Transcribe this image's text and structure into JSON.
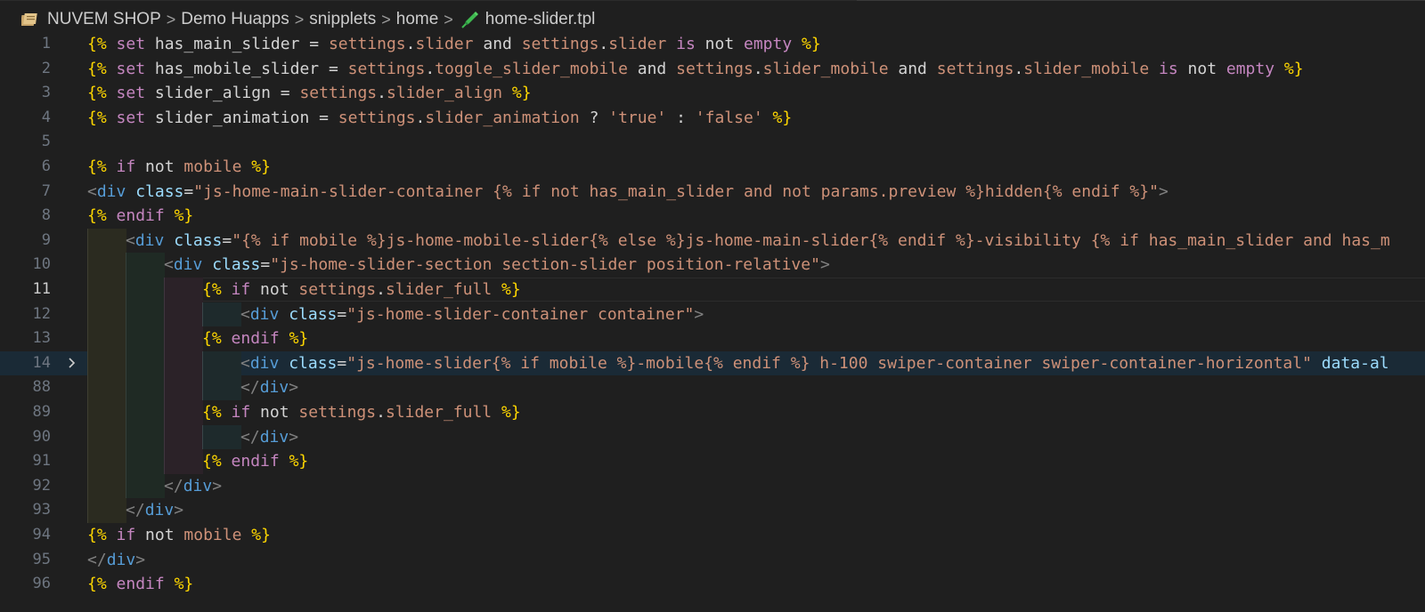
{
  "breadcrumb": {
    "items": [
      "NUVEM SHOP",
      "Demo Huapps",
      "snipplets",
      "home",
      "home-slider.tpl"
    ],
    "separator": ">",
    "file_icon": "pencil-icon",
    "root_icon": "folder-icon"
  },
  "editor": {
    "language": "twig",
    "current_line": "11",
    "folded_line": "14",
    "lines": [
      {
        "n": "1",
        "tokens": [
          [
            "brace",
            "{%"
          ],
          [
            "kw",
            " set"
          ],
          [
            "plain",
            " has_main_slider = "
          ],
          [
            "var",
            "settings"
          ],
          [
            "plain",
            "."
          ],
          [
            "var",
            "slider"
          ],
          [
            "plain",
            " and "
          ],
          [
            "var",
            "settings"
          ],
          [
            "plain",
            "."
          ],
          [
            "var",
            "slider"
          ],
          [
            "kw",
            " is"
          ],
          [
            "plain",
            " not "
          ],
          [
            "kw",
            "empty"
          ],
          [
            "plain",
            " "
          ],
          [
            "brace",
            "%}"
          ]
        ]
      },
      {
        "n": "2",
        "tokens": [
          [
            "brace",
            "{%"
          ],
          [
            "kw",
            " set"
          ],
          [
            "plain",
            " has_mobile_slider = "
          ],
          [
            "var",
            "settings"
          ],
          [
            "plain",
            "."
          ],
          [
            "var",
            "toggle_slider_mobile"
          ],
          [
            "plain",
            " and "
          ],
          [
            "var",
            "settings"
          ],
          [
            "plain",
            "."
          ],
          [
            "var",
            "slider_mobile"
          ],
          [
            "plain",
            " and "
          ],
          [
            "var",
            "settings"
          ],
          [
            "plain",
            "."
          ],
          [
            "var",
            "slider_mobile"
          ],
          [
            "kw",
            " is"
          ],
          [
            "plain",
            " not "
          ],
          [
            "kw",
            "empty"
          ],
          [
            "plain",
            " "
          ],
          [
            "brace",
            "%}"
          ]
        ]
      },
      {
        "n": "3",
        "tokens": [
          [
            "brace",
            "{%"
          ],
          [
            "kw",
            " set"
          ],
          [
            "plain",
            " slider_align = "
          ],
          [
            "var",
            "settings"
          ],
          [
            "plain",
            "."
          ],
          [
            "var",
            "slider_align"
          ],
          [
            "plain",
            " "
          ],
          [
            "brace",
            "%}"
          ]
        ]
      },
      {
        "n": "4",
        "tokens": [
          [
            "brace",
            "{%"
          ],
          [
            "kw",
            " set"
          ],
          [
            "plain",
            " slider_animation = "
          ],
          [
            "var",
            "settings"
          ],
          [
            "plain",
            "."
          ],
          [
            "var",
            "slider_animation"
          ],
          [
            "plain",
            " ? "
          ],
          [
            "str",
            "'true'"
          ],
          [
            "plain",
            " : "
          ],
          [
            "str",
            "'false'"
          ],
          [
            "plain",
            " "
          ],
          [
            "brace",
            "%}"
          ]
        ]
      },
      {
        "n": "5",
        "tokens": []
      },
      {
        "n": "6",
        "tokens": [
          [
            "brace",
            "{%"
          ],
          [
            "kw",
            " if"
          ],
          [
            "plain",
            " not "
          ],
          [
            "var",
            "mobile"
          ],
          [
            "plain",
            " "
          ],
          [
            "brace",
            "%}"
          ]
        ]
      },
      {
        "n": "7",
        "tokens": [
          [
            "punct",
            "<"
          ],
          [
            "tag",
            "div"
          ],
          [
            "attr",
            " class"
          ],
          [
            "plain",
            "="
          ],
          [
            "str",
            "\"js-home-main-slider-container {% if not has_main_slider and not params.preview %}hidden{% endif %}\""
          ],
          [
            "punct",
            ">"
          ]
        ]
      },
      {
        "n": "8",
        "tokens": [
          [
            "brace",
            "{%"
          ],
          [
            "kw",
            " endif"
          ],
          [
            "plain",
            " "
          ],
          [
            "brace",
            "%}"
          ]
        ]
      },
      {
        "n": "9",
        "tokens": [
          [
            "punct",
            "<"
          ],
          [
            "tag",
            "div"
          ],
          [
            "attr",
            " class"
          ],
          [
            "plain",
            "="
          ],
          [
            "str",
            "\"{% if mobile %}js-home-mobile-slider{% else %}js-home-main-slider{% endif %}-visibility {% if has_main_slider and has_m"
          ]
        ]
      },
      {
        "n": "10",
        "tokens": [
          [
            "punct",
            "<"
          ],
          [
            "tag",
            "div"
          ],
          [
            "attr",
            " class"
          ],
          [
            "plain",
            "="
          ],
          [
            "str",
            "\"js-home-slider-section section-slider position-relative\""
          ],
          [
            "punct",
            ">"
          ]
        ]
      },
      {
        "n": "11",
        "tokens": [
          [
            "brace",
            "{"
          ],
          [
            "brace",
            "% "
          ],
          [
            "kw",
            "if"
          ],
          [
            "plain",
            " not "
          ],
          [
            "var",
            "settings"
          ],
          [
            "plain",
            "."
          ],
          [
            "var",
            "slider_full"
          ],
          [
            "plain",
            " "
          ],
          [
            "brace",
            "%}"
          ]
        ]
      },
      {
        "n": "12",
        "tokens": [
          [
            "punct",
            "<"
          ],
          [
            "tag",
            "div"
          ],
          [
            "attr",
            " class"
          ],
          [
            "plain",
            "="
          ],
          [
            "str",
            "\"js-home-slider-container container\""
          ],
          [
            "punct",
            ">"
          ]
        ]
      },
      {
        "n": "13",
        "tokens": [
          [
            "brace",
            "{%"
          ],
          [
            "kw",
            " endif"
          ],
          [
            "plain",
            " "
          ],
          [
            "brace",
            "%}"
          ]
        ]
      },
      {
        "n": "14",
        "tokens": [
          [
            "punct",
            "<"
          ],
          [
            "tag",
            "div"
          ],
          [
            "attr",
            " class"
          ],
          [
            "plain",
            "="
          ],
          [
            "str",
            "\"js-home-slider{% if mobile %}-mobile{% endif %} h-100 swiper-container swiper-container-horizontal\""
          ],
          [
            "attr",
            " data-al"
          ]
        ]
      },
      {
        "n": "88",
        "tokens": [
          [
            "punct",
            "</"
          ],
          [
            "tag",
            "div"
          ],
          [
            "punct",
            ">"
          ]
        ]
      },
      {
        "n": "89",
        "tokens": [
          [
            "brace",
            "{%"
          ],
          [
            "kw",
            " if"
          ],
          [
            "plain",
            " not "
          ],
          [
            "var",
            "settings"
          ],
          [
            "plain",
            "."
          ],
          [
            "var",
            "slider_full"
          ],
          [
            "plain",
            " "
          ],
          [
            "brace",
            "%}"
          ]
        ]
      },
      {
        "n": "90",
        "tokens": [
          [
            "punct",
            "</"
          ],
          [
            "tag",
            "div"
          ],
          [
            "punct",
            ">"
          ]
        ]
      },
      {
        "n": "91",
        "tokens": [
          [
            "brace",
            "{%"
          ],
          [
            "kw",
            " endif"
          ],
          [
            "plain",
            " "
          ],
          [
            "brace",
            "%}"
          ]
        ]
      },
      {
        "n": "92",
        "tokens": [
          [
            "punct",
            "</"
          ],
          [
            "tag",
            "div"
          ],
          [
            "punct",
            ">"
          ]
        ]
      },
      {
        "n": "93",
        "tokens": [
          [
            "punct",
            "</"
          ],
          [
            "tag",
            "div"
          ],
          [
            "punct",
            ">"
          ]
        ]
      },
      {
        "n": "94",
        "tokens": [
          [
            "brace",
            "{%"
          ],
          [
            "kw",
            " if"
          ],
          [
            "plain",
            " not "
          ],
          [
            "var",
            "mobile"
          ],
          [
            "plain",
            " "
          ],
          [
            "brace",
            "%}"
          ]
        ]
      },
      {
        "n": "95",
        "tokens": [
          [
            "punct",
            "</"
          ],
          [
            "tag",
            "div"
          ],
          [
            "punct",
            ">"
          ]
        ]
      },
      {
        "n": "96",
        "tokens": [
          [
            "brace",
            "{%"
          ],
          [
            "kw",
            " endif"
          ],
          [
            "plain",
            " "
          ],
          [
            "brace",
            "%}"
          ]
        ]
      }
    ]
  },
  "colors": {
    "background": "#1f1f1f",
    "brace": "#ffd700",
    "keyword": "#c586c0",
    "variable": "#ce9178",
    "tag": "#569cd6",
    "attribute": "#9cdcfe",
    "string": "#ce9178",
    "line_number": "#6e7681"
  }
}
